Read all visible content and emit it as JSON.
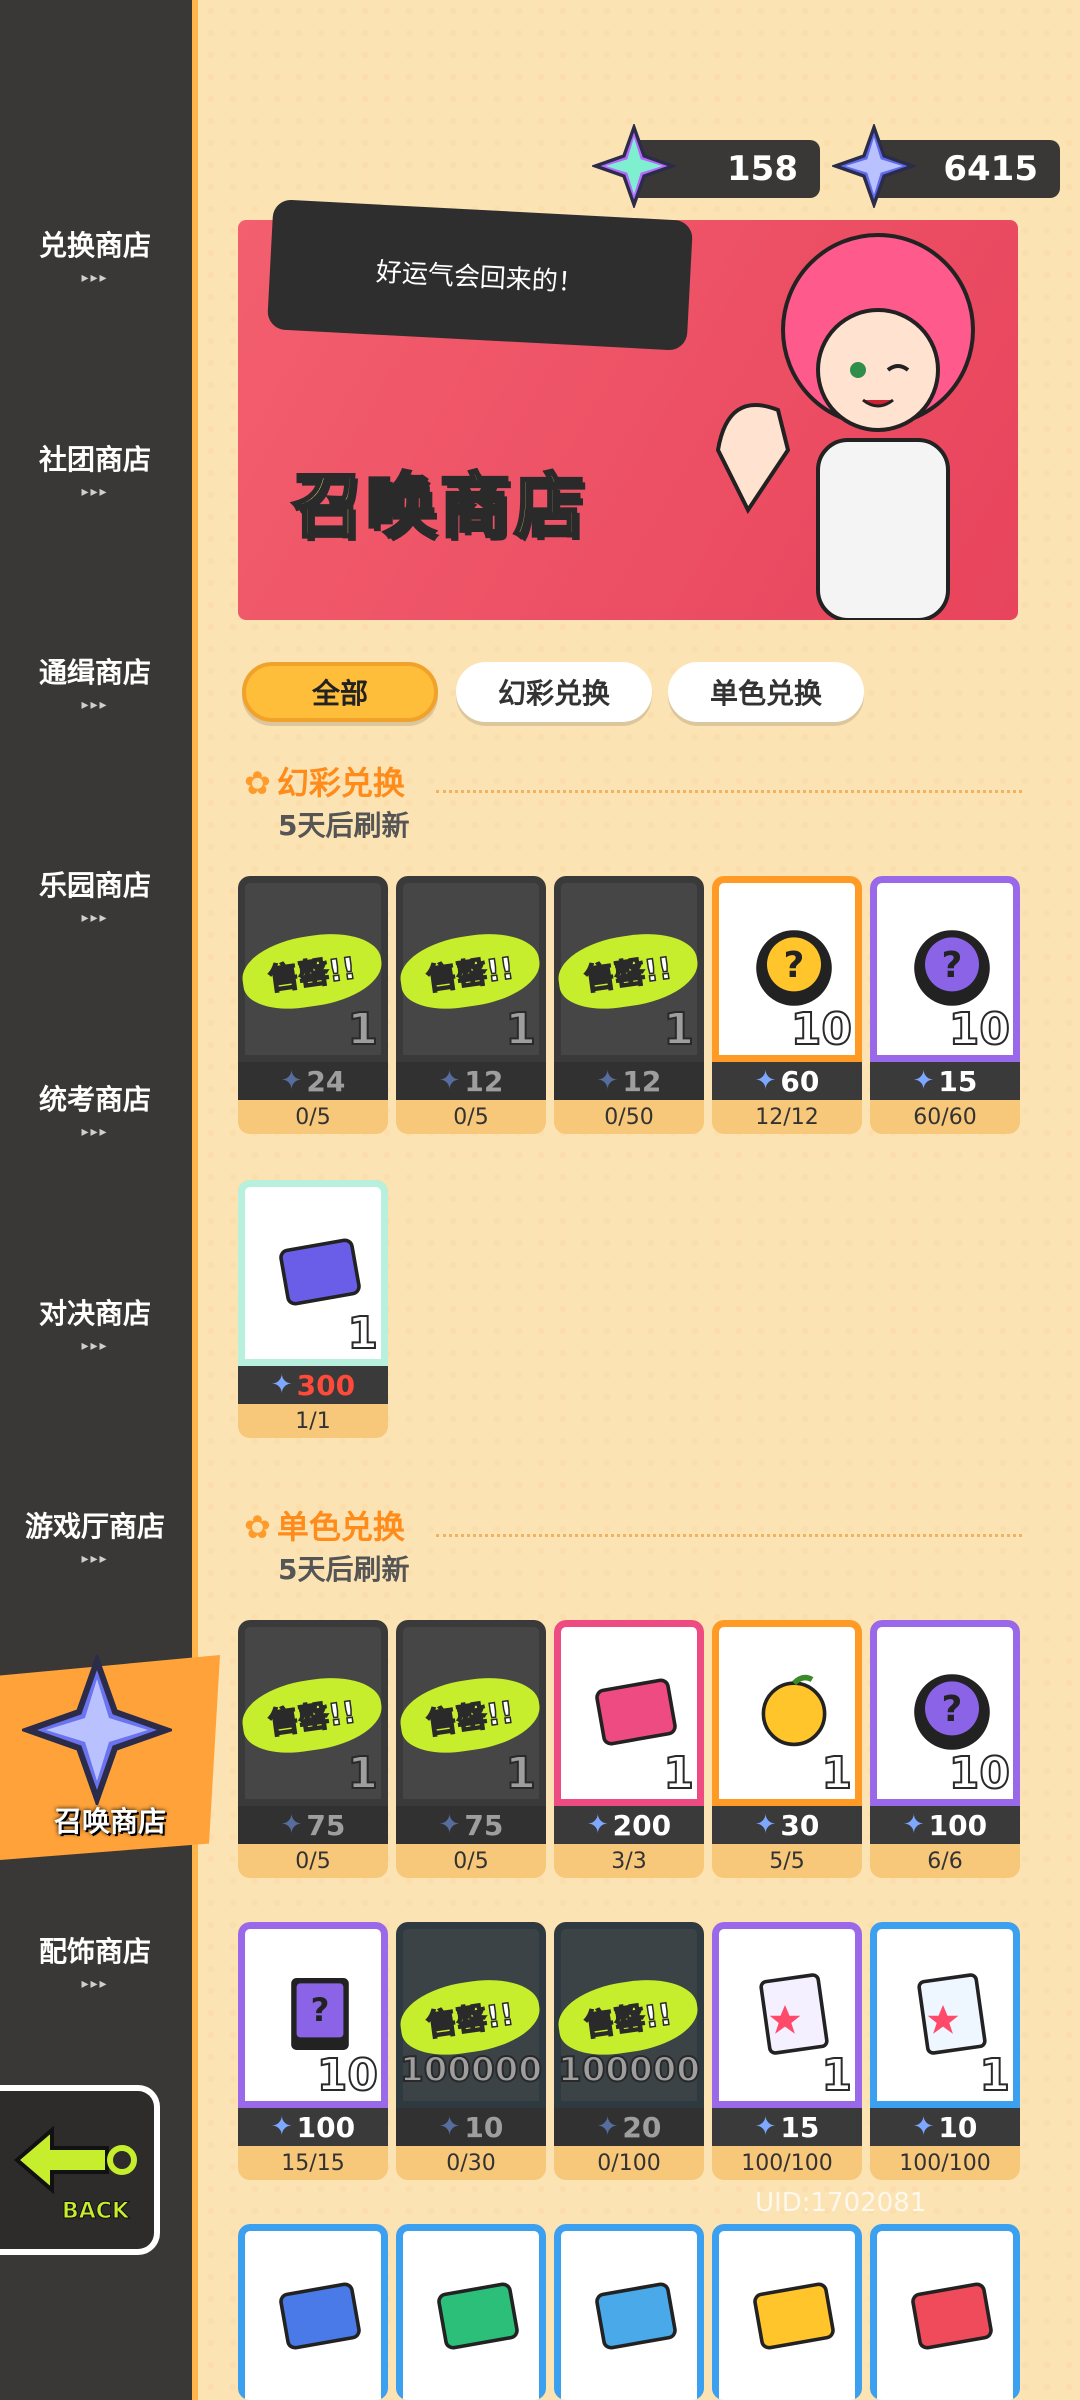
{
  "sidebar": {
    "items": [
      {
        "label": "兑换商店"
      },
      {
        "label": "社团商店"
      },
      {
        "label": "通缉商店"
      },
      {
        "label": "乐园商店"
      },
      {
        "label": "统考商店"
      },
      {
        "label": "对决商店"
      },
      {
        "label": "游戏厅商店"
      },
      {
        "label": "召唤商店"
      },
      {
        "label": "配饰商店"
      }
    ],
    "more_dots": "▸▸▸",
    "back_label": "BACK"
  },
  "currency": {
    "rainbow_star": "158",
    "blue_star": "6415"
  },
  "banner": {
    "speech": "好运气会回来的！",
    "title": "召唤商店"
  },
  "tabs": [
    {
      "label": "全部",
      "active": true
    },
    {
      "label": "幻彩兑换",
      "active": false
    },
    {
      "label": "单色兑换",
      "active": false
    }
  ],
  "sections": [
    {
      "title": "幻彩兑换",
      "refresh": "5天后刷新"
    },
    {
      "title": "单色兑换",
      "refresh": "5天后刷新"
    }
  ],
  "soldout_label": "售罄!!",
  "items": [
    {
      "qty": "1",
      "price": "24",
      "limit": "0/5"
    },
    {
      "qty": "1",
      "price": "12",
      "limit": "0/5"
    },
    {
      "qty": "1",
      "price": "12",
      "limit": "0/50"
    },
    {
      "qty": "10",
      "price": "60",
      "limit": "12/12"
    },
    {
      "qty": "10",
      "price": "15",
      "limit": "60/60"
    },
    {
      "qty": "1",
      "price": "300",
      "limit": "1/1"
    },
    {
      "qty": "1",
      "price": "75",
      "limit": "0/5"
    },
    {
      "qty": "1",
      "price": "75",
      "limit": "0/5"
    },
    {
      "qty": "1",
      "price": "200",
      "limit": "3/3"
    },
    {
      "qty": "1",
      "price": "30",
      "limit": "5/5"
    },
    {
      "qty": "10",
      "price": "100",
      "limit": "6/6"
    },
    {
      "qty": "10",
      "price": "100",
      "limit": "15/15"
    },
    {
      "qty": "100000",
      "price": "10",
      "limit": "0/30"
    },
    {
      "qty": "100000",
      "price": "20",
      "limit": "0/100"
    },
    {
      "qty": "1",
      "price": "15",
      "limit": "100/100"
    },
    {
      "qty": "1",
      "price": "10",
      "limit": "100/100"
    }
  ],
  "uid": "UID:1702081"
}
